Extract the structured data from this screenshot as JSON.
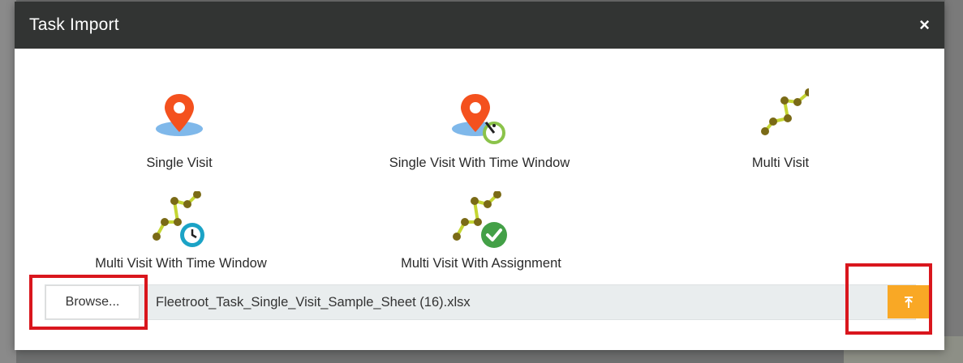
{
  "dialog": {
    "title": "Task Import",
    "close_label": "×"
  },
  "options": [
    {
      "label": "Single Visit",
      "icon": "pin-icon"
    },
    {
      "label": "Single Visit With Time Window",
      "icon": "pin-timer-icon"
    },
    {
      "label": "Multi Visit",
      "icon": "route-icon"
    },
    {
      "label": "Multi Visit With Time Window",
      "icon": "route-clock-icon"
    },
    {
      "label": "Multi Visit With Assignment",
      "icon": "route-check-icon"
    }
  ],
  "upload": {
    "browse_label": "Browse...",
    "file_name": "Fleetroot_Task_Single_Visit_Sample_Sheet (16).xlsx",
    "upload_icon": "upload-icon"
  },
  "colors": {
    "header_bg": "#323433",
    "pin": "#f4511e",
    "pin_shadow": "#7fb8ea",
    "route_line": "#c5d633",
    "route_dot": "#7a6a16",
    "timer": "#8bc34a",
    "clock": "#1ba3c6",
    "check": "#43a047",
    "upload_btn": "#f9a825",
    "highlight": "#d9161d"
  }
}
